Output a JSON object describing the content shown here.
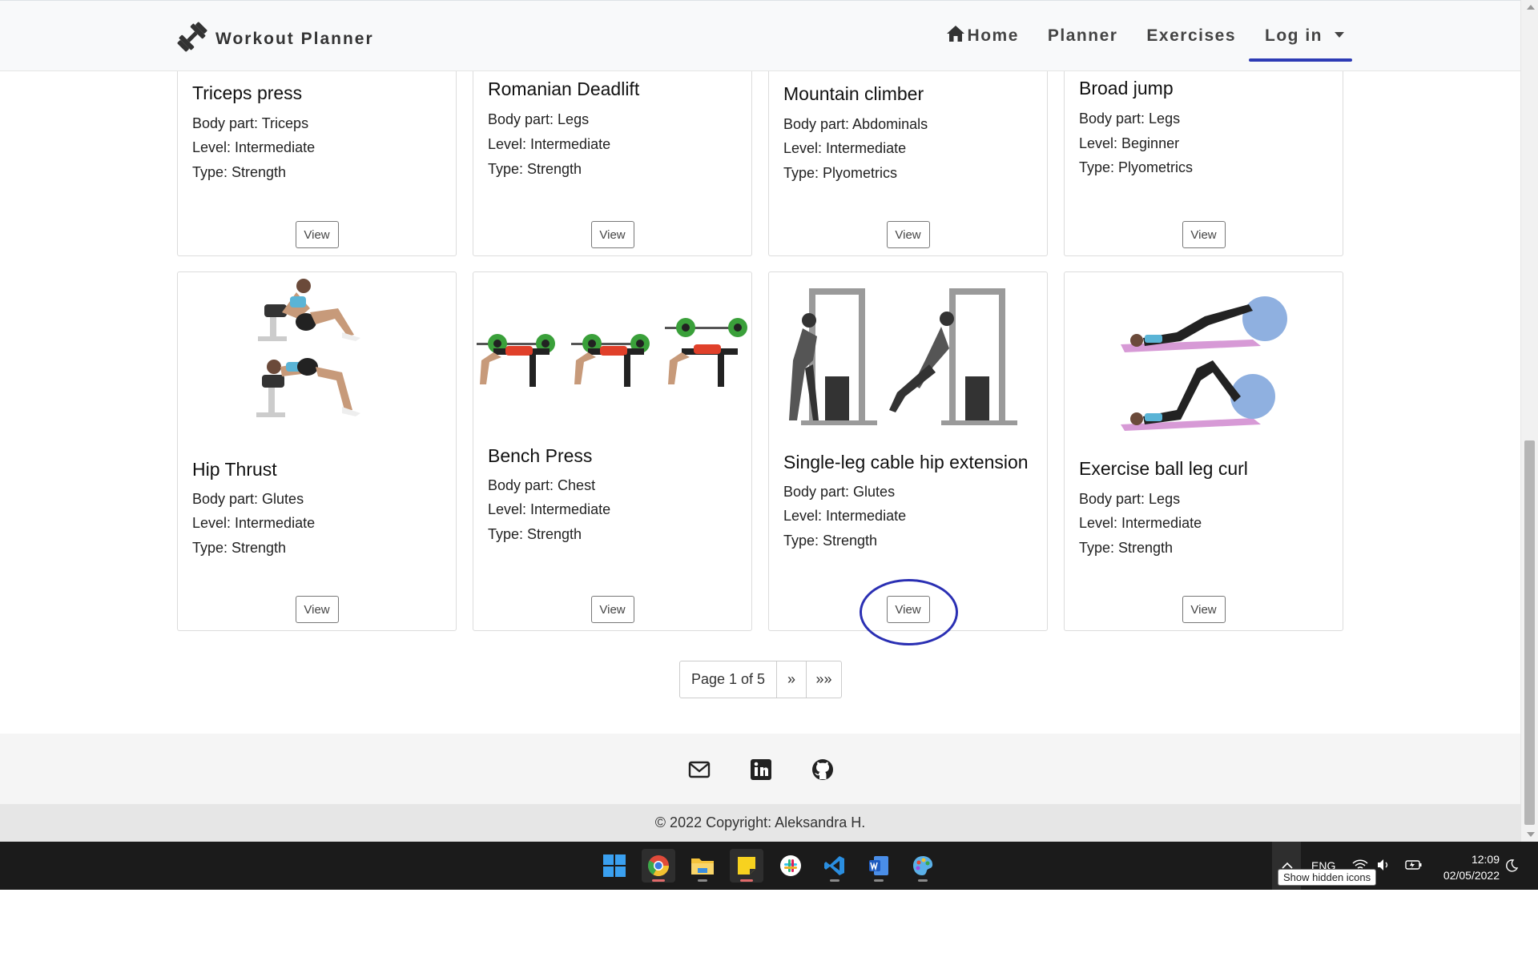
{
  "nav": {
    "brand": "Workout Planner",
    "links": [
      {
        "label": "Home",
        "icon": "home-icon"
      },
      {
        "label": "Planner"
      },
      {
        "label": "Exercises"
      },
      {
        "label": "Log in",
        "active": true
      }
    ],
    "accent_color": "#2d3bb5"
  },
  "cards_row1": [
    {
      "title": "Triceps press",
      "body_part": "Body part: Triceps",
      "level": "Level: Intermediate",
      "type": "Type: Strength",
      "button": "View"
    },
    {
      "title": "Romanian Deadlift",
      "body_part": "Body part: Legs",
      "level": "Level: Intermediate",
      "type": "Type: Strength",
      "button": "View"
    },
    {
      "title": "Mountain climber",
      "body_part": "Body part: Abdominals",
      "level": "Level: Intermediate",
      "type": "Type: Plyometrics",
      "button": "View"
    },
    {
      "title": "Broad jump",
      "body_part": "Body part: Legs",
      "level": "Level: Beginner",
      "type": "Type: Plyometrics",
      "button": "View"
    }
  ],
  "cards_row2": [
    {
      "title": "Hip Thrust",
      "body_part": "Body part: Glutes",
      "level": "Level: Intermediate",
      "type": "Type: Strength",
      "button": "View",
      "image": "hip-thrust-illustration"
    },
    {
      "title": "Bench Press",
      "body_part": "Body part: Chest",
      "level": "Level: Intermediate",
      "type": "Type: Strength",
      "button": "View",
      "image": "bench-press-illustration"
    },
    {
      "title": "Single-leg cable hip extension",
      "body_part": "Body part: Glutes",
      "level": "Level: Intermediate",
      "type": "Type: Strength",
      "button": "View",
      "image": "cable-hip-extension-illustration",
      "highlighted": true
    },
    {
      "title": "Exercise ball leg curl",
      "body_part": "Body part: Legs",
      "level": "Level: Intermediate",
      "type": "Type: Strength",
      "button": "View",
      "image": "ball-leg-curl-illustration"
    }
  ],
  "pagination": {
    "page_text": "Page 1 of 5",
    "next": "»",
    "last": "»»"
  },
  "footer": {
    "icons": [
      "email-icon",
      "linkedin-icon",
      "github-icon"
    ],
    "copyright": "© 2022 Copyright: Aleksandra H."
  },
  "taskbar": {
    "apps": [
      "windows-start-icon",
      "chrome-icon",
      "file-explorer-icon",
      "sticky-notes-icon",
      "slack-icon",
      "vscode-icon",
      "word-icon",
      "paint-icon"
    ],
    "language": "ENG",
    "time": "12:09",
    "date": "02/05/2022",
    "tooltip": "Show hidden icons"
  },
  "annotation_color": "#2a2fb3"
}
